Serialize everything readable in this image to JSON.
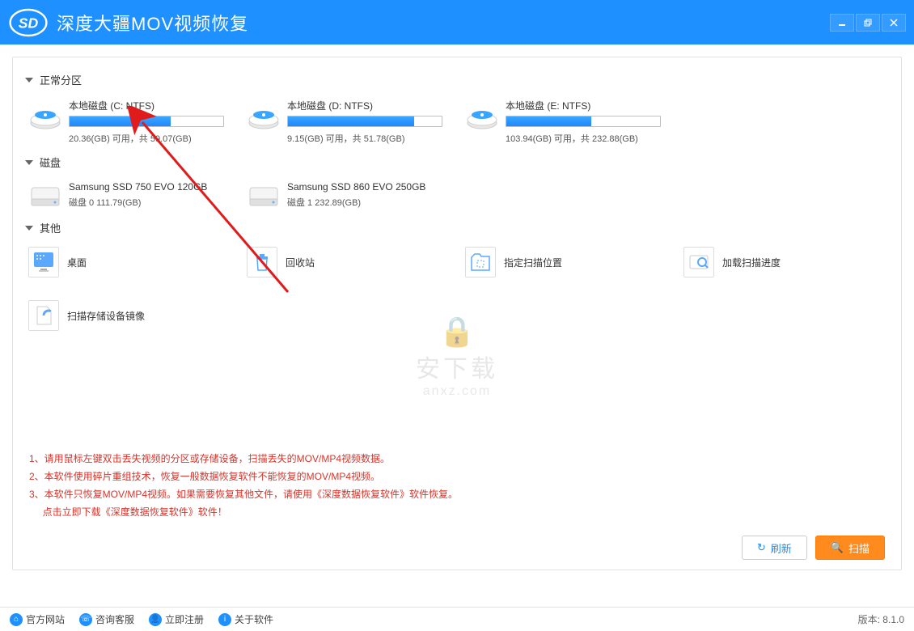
{
  "app": {
    "title": "深度大疆MOV视频恢复"
  },
  "sections": {
    "partitions": "正常分区",
    "disks": "磁盘",
    "other": "其他"
  },
  "partitions": [
    {
      "name": "本地磁盘 (C: NTFS)",
      "free": "20.36(GB) 可用，共 59.07(GB)",
      "fill": 66
    },
    {
      "name": "本地磁盘 (D: NTFS)",
      "free": "9.15(GB) 可用，共 51.78(GB)",
      "fill": 82
    },
    {
      "name": "本地磁盘 (E: NTFS)",
      "free": "103.94(GB) 可用，共 232.88(GB)",
      "fill": 55
    }
  ],
  "disks": [
    {
      "name": "Samsung SSD 750 EVO 120GB",
      "stats": "磁盘 0    111.79(GB)"
    },
    {
      "name": "Samsung SSD 860 EVO 250GB",
      "stats": "磁盘 1    232.89(GB)"
    }
  ],
  "other": [
    {
      "key": "desktop",
      "label": "桌面"
    },
    {
      "key": "recycle",
      "label": "回收站"
    },
    {
      "key": "setloc",
      "label": "指定扫描位置"
    },
    {
      "key": "loadprog",
      "label": "加载扫描进度"
    },
    {
      "key": "scanimg",
      "label": "扫描存储设备镜像"
    }
  ],
  "tips": {
    "l1": "1、请用鼠标左键双击丢失视频的分区或存储设备，扫描丢失的MOV/MP4视频数据。",
    "l2": "2、本软件使用碎片重组技术，恢复一般数据恢复软件不能恢复的MOV/MP4视频。",
    "l3": "3、本软件只恢复MOV/MP4视频。如果需要恢复其他文件，请使用《深度数据恢复软件》软件恢复。",
    "l4pre": "点击立即下载",
    "l4link": "《深度数据恢复软件》",
    "l4post": "软件！"
  },
  "buttons": {
    "refresh": "刷新",
    "scan": "扫描"
  },
  "footer": {
    "site": "官方网站",
    "service": "咨询客服",
    "register": "立即注册",
    "about": "关于软件",
    "version": "版本: 8.1.0"
  },
  "watermark": {
    "t1": "安下载",
    "t2": "anxz.com"
  }
}
